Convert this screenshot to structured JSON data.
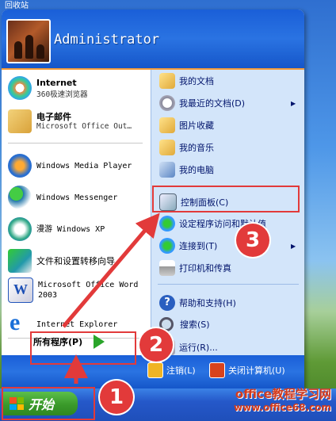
{
  "desktop": {
    "corner_label": "回收站"
  },
  "user": {
    "name": "Administrator"
  },
  "left_items": [
    {
      "title": "Internet",
      "subtitle": "360极速浏览器",
      "icon": "360-browser-icon"
    },
    {
      "title": "电子邮件",
      "subtitle": "Microsoft Office Out…",
      "icon": "outlook-icon"
    },
    {
      "title": "Windows Media Player",
      "icon": "media-player-icon"
    },
    {
      "title": "Windows Messenger",
      "icon": "messenger-icon"
    },
    {
      "title": "漫游 Windows XP",
      "icon": "tour-xp-icon"
    },
    {
      "title": "文件和设置转移向导",
      "icon": "transfer-wizard-icon"
    },
    {
      "title": "Microsoft Office Word 2003",
      "icon": "word-icon"
    },
    {
      "title": "Internet Explorer",
      "icon": "ie-icon"
    }
  ],
  "all_programs": {
    "label": "所有程序(P)"
  },
  "right_items": [
    {
      "label": "我的文档",
      "icon": "my-documents-icon"
    },
    {
      "label": "我最近的文档(D)",
      "icon": "recent-documents-icon"
    },
    {
      "label": "图片收藏",
      "icon": "my-pictures-icon"
    },
    {
      "label": "我的音乐",
      "icon": "my-music-icon"
    },
    {
      "label": "我的电脑",
      "icon": "my-computer-icon"
    },
    {
      "label": "控制面板(C)",
      "icon": "control-panel-icon"
    },
    {
      "label": "设定程序访问和默认值",
      "icon": "program-access-icon"
    },
    {
      "label": "连接到(T)",
      "icon": "connect-to-icon"
    },
    {
      "label": "打印机和传真",
      "icon": "printers-icon"
    },
    {
      "label": "帮助和支持(H)",
      "icon": "help-icon"
    },
    {
      "label": "搜索(S)",
      "icon": "search-icon"
    },
    {
      "label": "运行(R)...",
      "icon": "run-icon"
    }
  ],
  "footer": {
    "logoff": "注销(L)",
    "shutdown": "关闭计算机(U)"
  },
  "taskbar": {
    "start_label": "开始"
  },
  "annotations": {
    "step1": "1",
    "step2": "2",
    "step3": "3",
    "color": "#e23a3a"
  },
  "watermark": {
    "line1": "office教程学习网",
    "line2": "www.office68.com"
  }
}
